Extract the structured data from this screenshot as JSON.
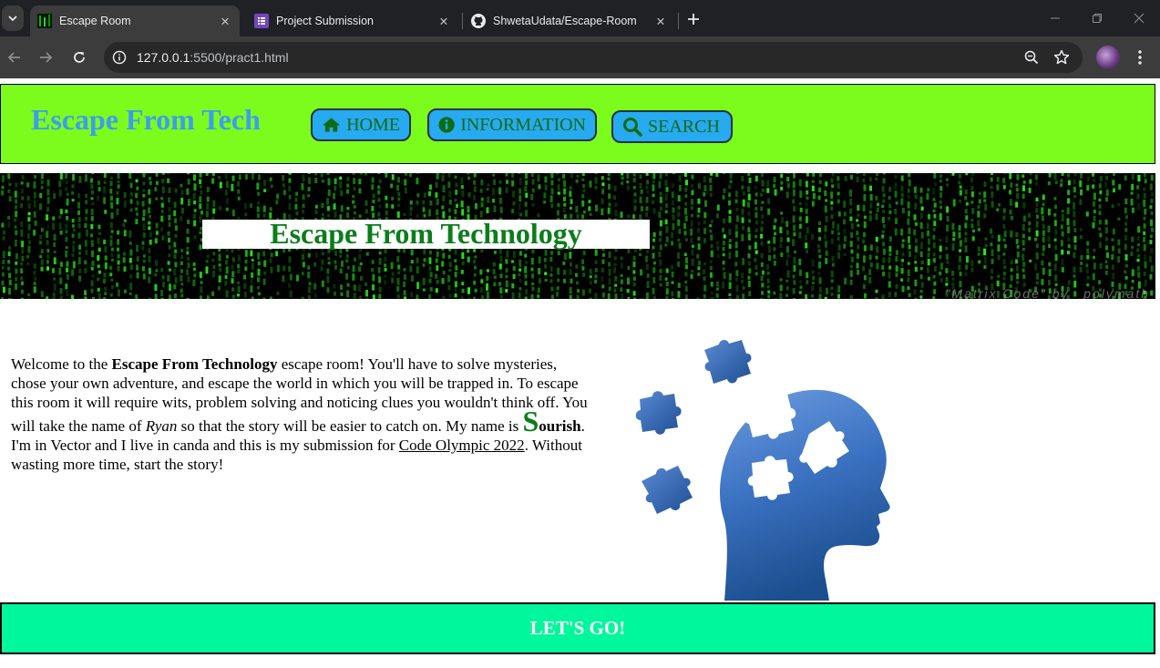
{
  "browser": {
    "tabs": [
      {
        "title": "Escape Room",
        "active": true,
        "icon": "matrix-favicon-icon"
      },
      {
        "title": "Project Submission",
        "active": false,
        "icon": "form-favicon-icon"
      },
      {
        "title": "ShwetaUdata/Escape-Room",
        "active": false,
        "icon": "github-icon"
      }
    ],
    "url_host": "127.0.0.1",
    "url_path": ":5500/pract1.html"
  },
  "header": {
    "brand": "Escape From Tech",
    "nav": [
      {
        "label": "HOME",
        "icon": "home-icon"
      },
      {
        "label": "INFORMATION",
        "icon": "info-icon"
      },
      {
        "label": "SEARCH",
        "icon": "search-icon"
      }
    ],
    "background": "#7cfc1c",
    "pill_color": "#27aaf0"
  },
  "banner": {
    "title": "Escape From Technology",
    "credit": "\"Matrix Code\" by _polymath"
  },
  "intro": {
    "p1": "Welcome to the ",
    "bold1": "Escape From Technology",
    "p2": " escape room! You'll have to solve mysteries, chose your own adventure, and escape the world in which you will be trapped in. To escape this room it will require wits, problem solving and noticing clues you wouldn't think off. You will take the name of ",
    "italic1": "Ryan",
    "p3": " so that the story will be easier to catch on. My name is ",
    "big_letter": "S",
    "bold2": "ourish",
    "p4": ". I'm in Vector and I live in canda and this is my submission for ",
    "link": "Code Olympic 2022",
    "p5": ". Without wasting more time, start the story!"
  },
  "image": {
    "name": "head-puzzle-image"
  },
  "cta": {
    "label": "LET'S GO!",
    "color": "#00f79b"
  }
}
